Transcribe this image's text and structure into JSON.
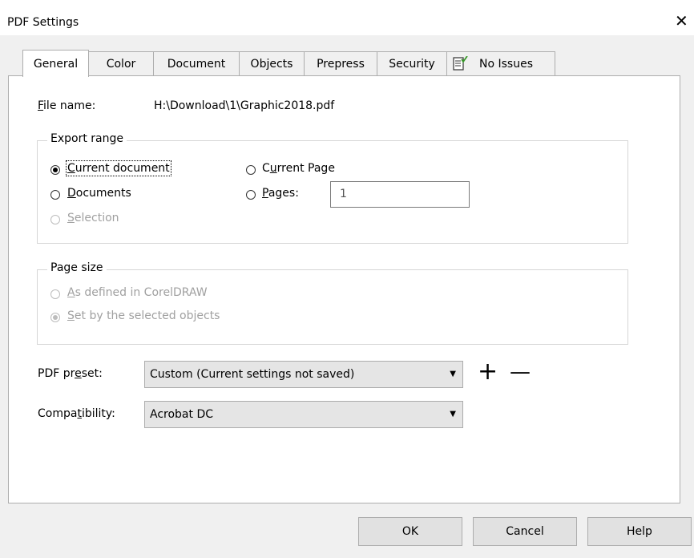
{
  "window": {
    "title": "PDF Settings",
    "close_glyph": "✕"
  },
  "tabs": [
    {
      "label": "General",
      "active": true
    },
    {
      "label": "Color"
    },
    {
      "label": "Document"
    },
    {
      "label": "Objects"
    },
    {
      "label": "Prepress"
    },
    {
      "label": "Security"
    },
    {
      "label": "No Issues",
      "icon": "checklist-icon"
    }
  ],
  "file": {
    "label_accel": "F",
    "label_rest": "ile name:",
    "value": "H:\\Download\\1\\Graphic2018.pdf"
  },
  "export_range": {
    "legend": "Export range",
    "current_document": {
      "accel": "C",
      "rest": "urrent document",
      "checked": true
    },
    "current_page": {
      "before": "C",
      "accel": "u",
      "rest": "rrent Page"
    },
    "documents": {
      "accel": "D",
      "rest": "ocuments"
    },
    "pages": {
      "accel": "P",
      "rest": "ages:",
      "value": "1"
    },
    "selection": {
      "accel": "S",
      "rest": "election",
      "disabled": true
    }
  },
  "page_size": {
    "legend": "Page size",
    "as_defined": {
      "accel": "A",
      "rest": "s defined in CorelDRAW",
      "disabled": true
    },
    "set_by_objects": {
      "accel": "S",
      "rest": "et by the selected objects",
      "checked": true,
      "disabled": true
    }
  },
  "preset": {
    "label_before": "PDF pr",
    "label_accel": "e",
    "label_after": "set:",
    "value": "Custom (Current settings not saved)",
    "add_glyph": "+",
    "remove_glyph": "—"
  },
  "compat": {
    "label_before": "Compa",
    "label_accel": "t",
    "label_after": "ibility:",
    "value": "Acrobat DC"
  },
  "dropdown_arrow": "▼",
  "buttons": {
    "ok": "OK",
    "cancel": "Cancel",
    "help": "Help"
  }
}
